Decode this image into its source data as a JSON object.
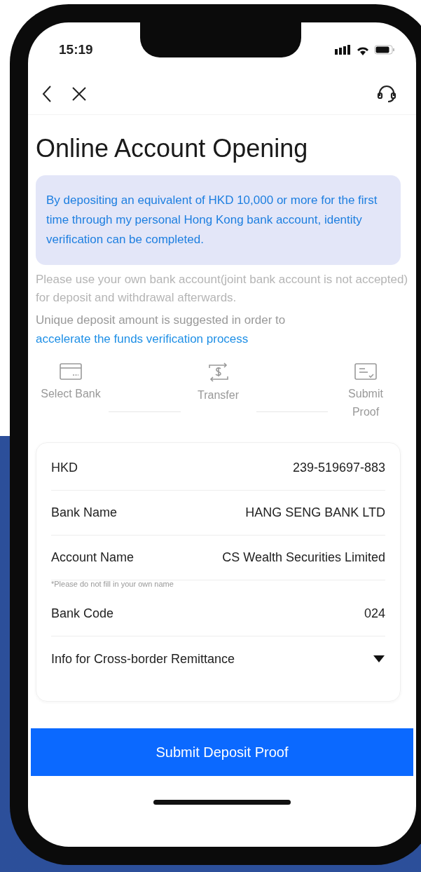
{
  "status_bar": {
    "time": "15:19"
  },
  "title": "Online Account Opening",
  "info_box": "By depositing an equivalent of HKD 10,000 or more for the first time through my personal Hong Kong bank account, identity verification can be completed.",
  "notice": "Please use your own bank account(joint bank account is not accepted) for deposit and withdrawal afterwards.",
  "suggestion": {
    "text": "Unique deposit amount is suggested in order to",
    "link": "accelerate the funds verification process"
  },
  "steps": [
    {
      "label": "Select Bank",
      "kind": "bank"
    },
    {
      "label": "Transfer",
      "kind": "transfer"
    },
    {
      "label": "Submit Proof",
      "kind": "proof"
    }
  ],
  "details": [
    {
      "kind": "row",
      "label": "HKD",
      "value": "239-519697-883"
    },
    {
      "kind": "row",
      "label": "Bank Name",
      "value": "HANG SENG BANK LTD"
    },
    {
      "kind": "row",
      "label": "Account Name",
      "value": "CS Wealth Securities Limited"
    },
    {
      "kind": "note",
      "label": "*Please do not fill in your own name"
    },
    {
      "kind": "row",
      "label": "Bank Code",
      "value": "024"
    },
    {
      "kind": "expander",
      "label": "Info for Cross-border Remittance",
      "expanded": false
    }
  ],
  "submit_button": "Submit Deposit Proof"
}
